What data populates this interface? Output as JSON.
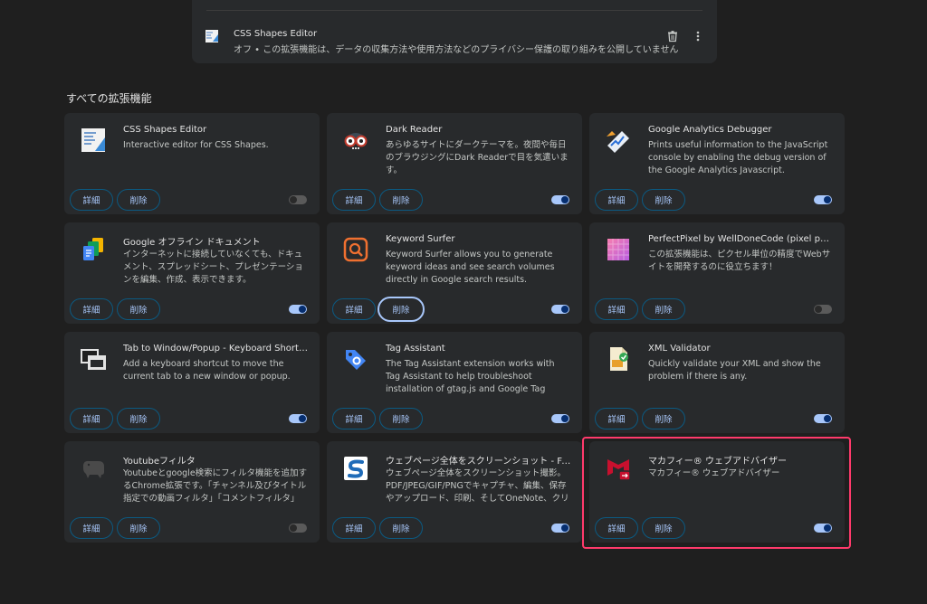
{
  "top_item": {
    "name": "CSS Shapes Editor",
    "description": "オフ • この拡張機能は、データの収集方法や使用方法などのプライバシー保護の取り組みを公開していません",
    "icon": "css-shapes-editor-icon"
  },
  "section_title": "すべての拡張機能",
  "labels": {
    "details": "詳細",
    "remove": "削除"
  },
  "colors": {
    "accent": "#a8c7fa",
    "highlight": "#ff3a6b",
    "card_bg": "#282a2c",
    "page_bg": "#1f1f1f"
  },
  "extensions": [
    {
      "name": "CSS Shapes Editor",
      "description": "Interactive editor for CSS Shapes.",
      "enabled": false,
      "icon": "css-shapes-editor-icon"
    },
    {
      "name": "Dark Reader",
      "description": "あらゆるサイトにダークテーマを。夜間や毎日のブラウジングにDark Readerで目を気遣います。",
      "enabled": true,
      "icon": "dark-reader-icon"
    },
    {
      "name": "Google Analytics Debugger",
      "description": "Prints useful information to the JavaScript console by enabling the debug version of the Google Analytics Javascript.",
      "enabled": true,
      "icon": "google-analytics-debugger-icon"
    },
    {
      "name": "Google オフライン ドキュメント",
      "description": "インターネットに接続していなくても、ドキュメント、スプレッドシート、プレゼンテーションを編集、作成、表示できます。",
      "enabled": true,
      "icon": "google-docs-offline-icon"
    },
    {
      "name": "Keyword Surfer",
      "description": "Keyword Surfer allows you to generate keyword ideas and see search volumes directly in Google search results.",
      "enabled": true,
      "icon": "keyword-surfer-icon"
    },
    {
      "name": "PerfectPixel by WellDoneCode (pixel perfect)",
      "description": "この拡張機能は、ピクセル単位の精度でWebサイトを開発するのに役立ちます！",
      "enabled": false,
      "icon": "perfectpixel-icon"
    },
    {
      "name": "Tab to Window/Popup - Keyboard Shortcut",
      "description": "Add a keyboard shortcut to move the current tab to a new window or popup.",
      "enabled": true,
      "icon": "tab-to-window-icon"
    },
    {
      "name": "Tag Assistant",
      "description": "The Tag Assistant extension works with Tag Assistant to help troubleshoot installation of gtag.js and Google Tag Manager.",
      "enabled": true,
      "icon": "tag-assistant-icon"
    },
    {
      "name": "XML Validator",
      "description": "Quickly validate your XML and show the problem if there is any.",
      "enabled": true,
      "icon": "xml-validator-icon"
    },
    {
      "name": "Youtubeフィルタ",
      "description": "Youtubeとgoogle検索にフィルタ機能を追加するChrome拡張です。「チャンネル及びタイトル指定での動画フィルタ」「コメントフィルタ」「自",
      "enabled": false,
      "icon": "youtube-filter-icon"
    },
    {
      "name": "ウェブページ全体をスクリーンショット - FireShot",
      "description": "ウェブページ全体をスクリーンショット撮影。PDF/JPEG/GIF/PNGでキャプチャ、編集、保存やアップロード、印刷、そしてOneNote、クリップ",
      "enabled": true,
      "icon": "fireshot-icon"
    },
    {
      "name": "マカフィー® ウェブアドバイザー",
      "description": "マカフィー® ウェブアドバイザー",
      "enabled": true,
      "icon": "mcafee-webadvisor-icon"
    }
  ]
}
